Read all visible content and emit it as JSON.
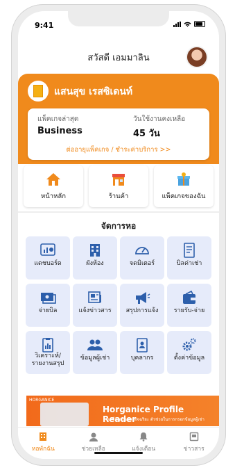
{
  "status": {
    "time": "9:41"
  },
  "header": {
    "greeting": "สวัสดี เอมมาลิน"
  },
  "dorm": {
    "name": "แสนสุข เรสซิเดนท์"
  },
  "package_card": {
    "package_label": "แพ็คเกจล่าสุด",
    "package_value": "Business",
    "days_label": "วันใช้งานคงเหลือ",
    "days_value": "45 วัน",
    "link": "ต่ออายุแพ็คเกจ / ชำระค่าบริการ >>"
  },
  "quick": [
    {
      "label": "หน้าหลัก",
      "icon": "house-icon"
    },
    {
      "label": "ร้านค้า",
      "icon": "shop-icon"
    },
    {
      "label": "แพ็คเกจของฉัน",
      "icon": "gift-box-icon"
    }
  ],
  "section": {
    "title": "จัดการหอ"
  },
  "grid": [
    {
      "label": "แดชบอร์ด",
      "icon": "dashboard-icon"
    },
    {
      "label": "ผังห้อง",
      "icon": "building-icon"
    },
    {
      "label": "จดมิเตอร์",
      "icon": "meter-icon"
    },
    {
      "label": "บิลค่าเช่า",
      "icon": "bill-icon"
    },
    {
      "label": "จ่ายบิล",
      "icon": "pay-bill-icon"
    },
    {
      "label": "แจ้งข่าวสาร",
      "icon": "news-icon"
    },
    {
      "label": "สรุปการแจ้ง",
      "icon": "megaphone-icon"
    },
    {
      "label": "รายรับ-จ่าย",
      "icon": "wallet-icon"
    },
    {
      "label": "วิเคราะห์/\nรายงานสรุป",
      "icon": "report-icon"
    },
    {
      "label": "ข้อมูลผู้เช่า",
      "icon": "tenants-icon"
    },
    {
      "label": "บุคลากร",
      "icon": "staff-icon"
    },
    {
      "label": "ตั้งค่าข้อมูล",
      "icon": "settings-icon"
    }
  ],
  "banner": {
    "brand": "HORGANICE",
    "title": "Horganice Profile Reader",
    "subtitle": "เครื่องอ่านบัตรอัจฉริยะ ตัวช่วยในการกรอกข้อมูลผู้เช่า"
  },
  "tabs": [
    {
      "label": "หอพักฉัน",
      "icon": "dorm-icon",
      "active": true
    },
    {
      "label": "ช่วยเหลือ",
      "icon": "support-icon",
      "active": false
    },
    {
      "label": "แจ้งเตือน",
      "icon": "bell-icon",
      "active": false
    },
    {
      "label": "ข่าวสาร",
      "icon": "news-tab-icon",
      "active": false
    }
  ],
  "colors": {
    "accent": "#f08a1c",
    "tile_bg": "#e6ebfa"
  }
}
